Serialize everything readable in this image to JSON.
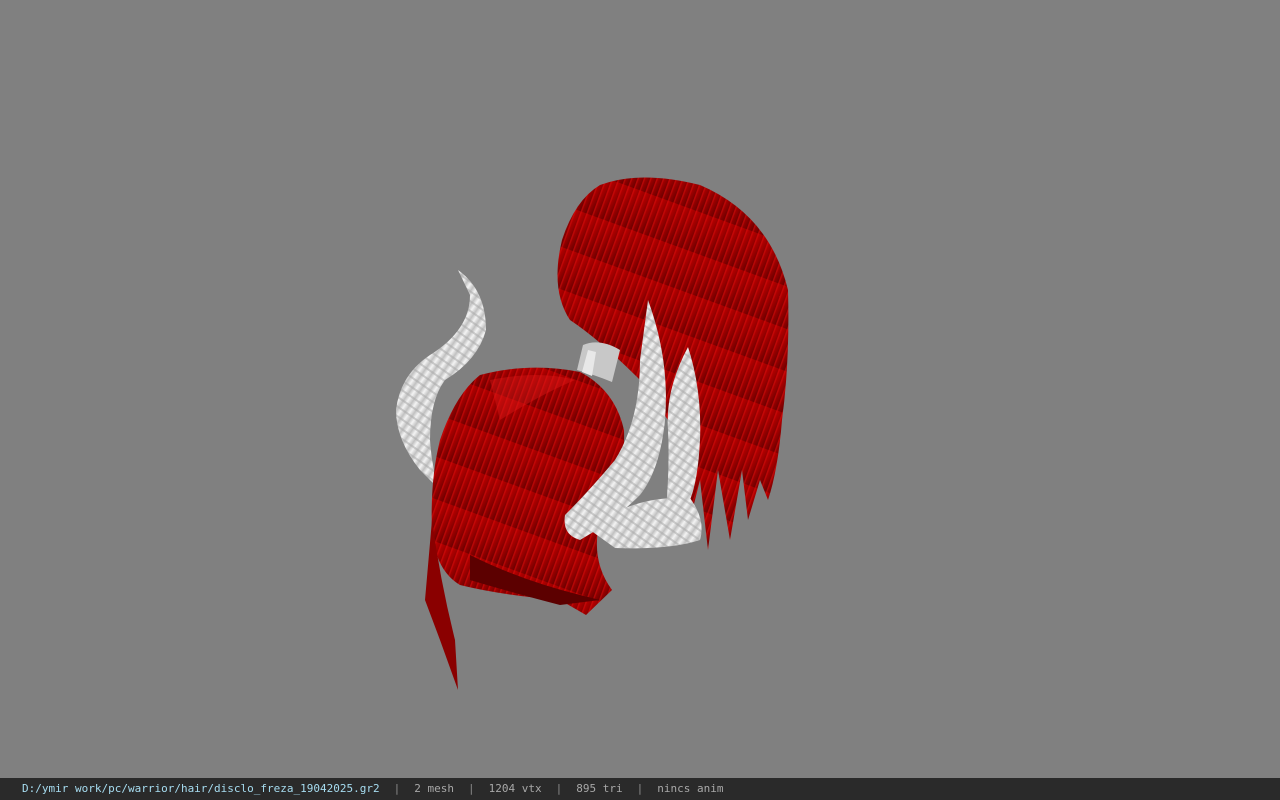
{
  "viewport": {
    "background": "#808080",
    "model_name": "hair-with-horns-model"
  },
  "statusbar": {
    "file_path": "D:/ymir work/pc/warrior/hair/disclo_freza_19042025.gr2",
    "separator": "|",
    "mesh_count": "2 mesh",
    "vertex_count": "1204 vtx",
    "triangle_count": "895 tri",
    "anim_status": "nincs anim"
  },
  "colors": {
    "hair_dark": "#7a0000",
    "hair_mid": "#b30000",
    "hair_light": "#d81010",
    "horn_light": "#f2f2f2",
    "horn_shadow": "#b8b8b8"
  }
}
